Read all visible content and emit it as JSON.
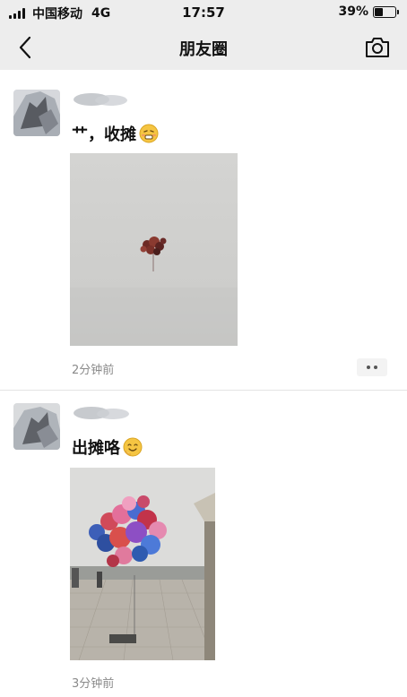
{
  "status_bar": {
    "carrier": "中国移动",
    "network": "4G",
    "time": "17:57",
    "battery_text": "39%",
    "battery_level": 0.39
  },
  "nav": {
    "title": "朋友圈",
    "back_icon": "chevron-left-icon",
    "camera_icon": "camera-icon"
  },
  "posts": [
    {
      "text": "艹，收摊",
      "emoji": "grimace-emoji",
      "time": "2分钟前"
    },
    {
      "text": "出摊咯",
      "emoji": "smile-emoji",
      "time": "3分钟前"
    }
  ],
  "colors": {
    "header_bg": "#ededed",
    "timestamp": "#8a8a8a",
    "divider": "#e4e4e4"
  }
}
